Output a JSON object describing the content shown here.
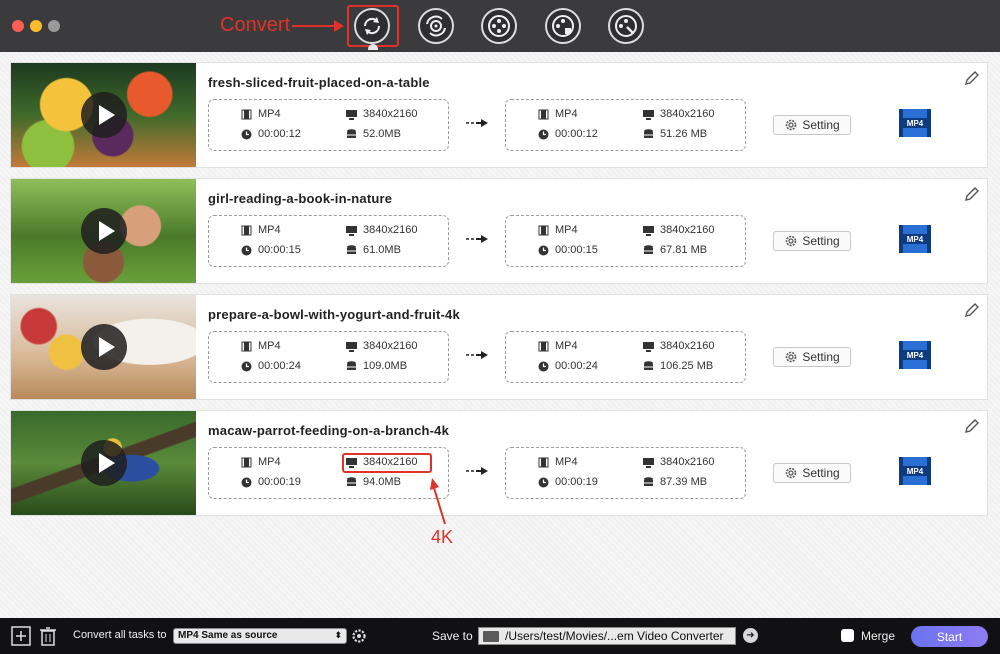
{
  "annotations": {
    "convert_label": "Convert",
    "fourk_label": "4K"
  },
  "toolbar": {
    "tools": [
      {
        "name": "convert",
        "icon": "convert-icon",
        "active": true
      },
      {
        "name": "convert-alt",
        "icon": "refresh-disc-icon"
      },
      {
        "name": "video-edit",
        "icon": "film-reel-icon"
      },
      {
        "name": "video-merge",
        "icon": "film-reel-plus-icon"
      },
      {
        "name": "video-tools",
        "icon": "film-reel-wrench-icon"
      }
    ]
  },
  "tasks": [
    {
      "name": "fresh-sliced-fruit-placed-on-a-table",
      "source": {
        "format": "MP4",
        "resolution": "3840x2160",
        "duration": "00:00:12",
        "size": "52.0MB"
      },
      "output": {
        "format": "MP4",
        "resolution": "3840x2160",
        "duration": "00:00:12",
        "size": "51.26 MB"
      },
      "setting_label": "Setting",
      "output_format_icon": "MP4"
    },
    {
      "name": "girl-reading-a-book-in-nature",
      "source": {
        "format": "MP4",
        "resolution": "3840x2160",
        "duration": "00:00:15",
        "size": "61.0MB"
      },
      "output": {
        "format": "MP4",
        "resolution": "3840x2160",
        "duration": "00:00:15",
        "size": "67.81 MB"
      },
      "setting_label": "Setting",
      "output_format_icon": "MP4"
    },
    {
      "name": "prepare-a-bowl-with-yogurt-and-fruit-4k",
      "source": {
        "format": "MP4",
        "resolution": "3840x2160",
        "duration": "00:00:24",
        "size": "109.0MB"
      },
      "output": {
        "format": "MP4",
        "resolution": "3840x2160",
        "duration": "00:00:24",
        "size": "106.25 MB"
      },
      "setting_label": "Setting",
      "output_format_icon": "MP4"
    },
    {
      "name": "macaw-parrot-feeding-on-a-branch-4k",
      "source": {
        "format": "MP4",
        "resolution": "3840x2160",
        "duration": "00:00:19",
        "size": "94.0MB"
      },
      "output": {
        "format": "MP4",
        "resolution": "3840x2160",
        "duration": "00:00:19",
        "size": "87.39 MB"
      },
      "setting_label": "Setting",
      "output_format_icon": "MP4"
    }
  ],
  "bottom": {
    "convert_all_label": "Convert all tasks to",
    "format_value": "MP4 Same as source",
    "save_to_label": "Save to",
    "save_path": "/Users/test/Movies/...em Video Converter",
    "merge_label": "Merge",
    "start_label": "Start"
  },
  "colors": {
    "annotation_red": "#e0322a",
    "titlebar": "#3b3b3e",
    "start_gradient_from": "#6b73f0",
    "start_gradient_to": "#8f7bf3",
    "mp4_icon_blue": "#2a6fd6"
  }
}
